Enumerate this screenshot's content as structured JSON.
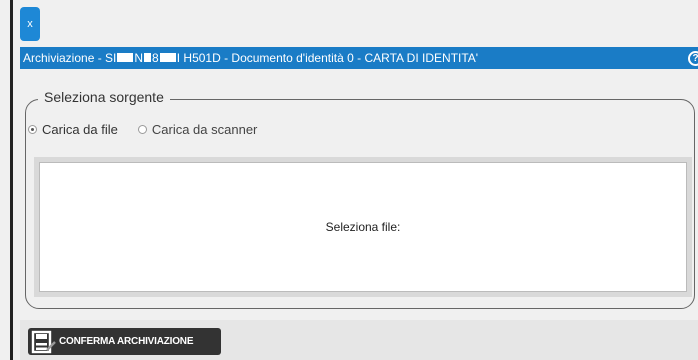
{
  "window": {
    "close_label": "x"
  },
  "title_bar": {
    "text_prefix": "Archiviazione - SI",
    "text_mid1": "N",
    "text_mid2": "8",
    "text_suffix": "I H501D - Documento d'identità 0 - CARTA DI IDENTITA'",
    "help_label": "?"
  },
  "source_panel": {
    "legend": "Seleziona sorgente",
    "options": [
      {
        "label": "Carica da file",
        "selected": true
      },
      {
        "label": "Carica da scanner",
        "selected": false
      }
    ],
    "drop_zone_label": "Seleziona file:"
  },
  "footer": {
    "confirm_label": "CONFERMA ARCHIVIAZIONE"
  },
  "colors": {
    "accent": "#1a7cc6",
    "close_button": "#1e88d6",
    "confirm_button": "#333333"
  },
  "icons": {
    "close": "close-icon",
    "help": "help-icon",
    "confirm": "save-disk-icon"
  }
}
